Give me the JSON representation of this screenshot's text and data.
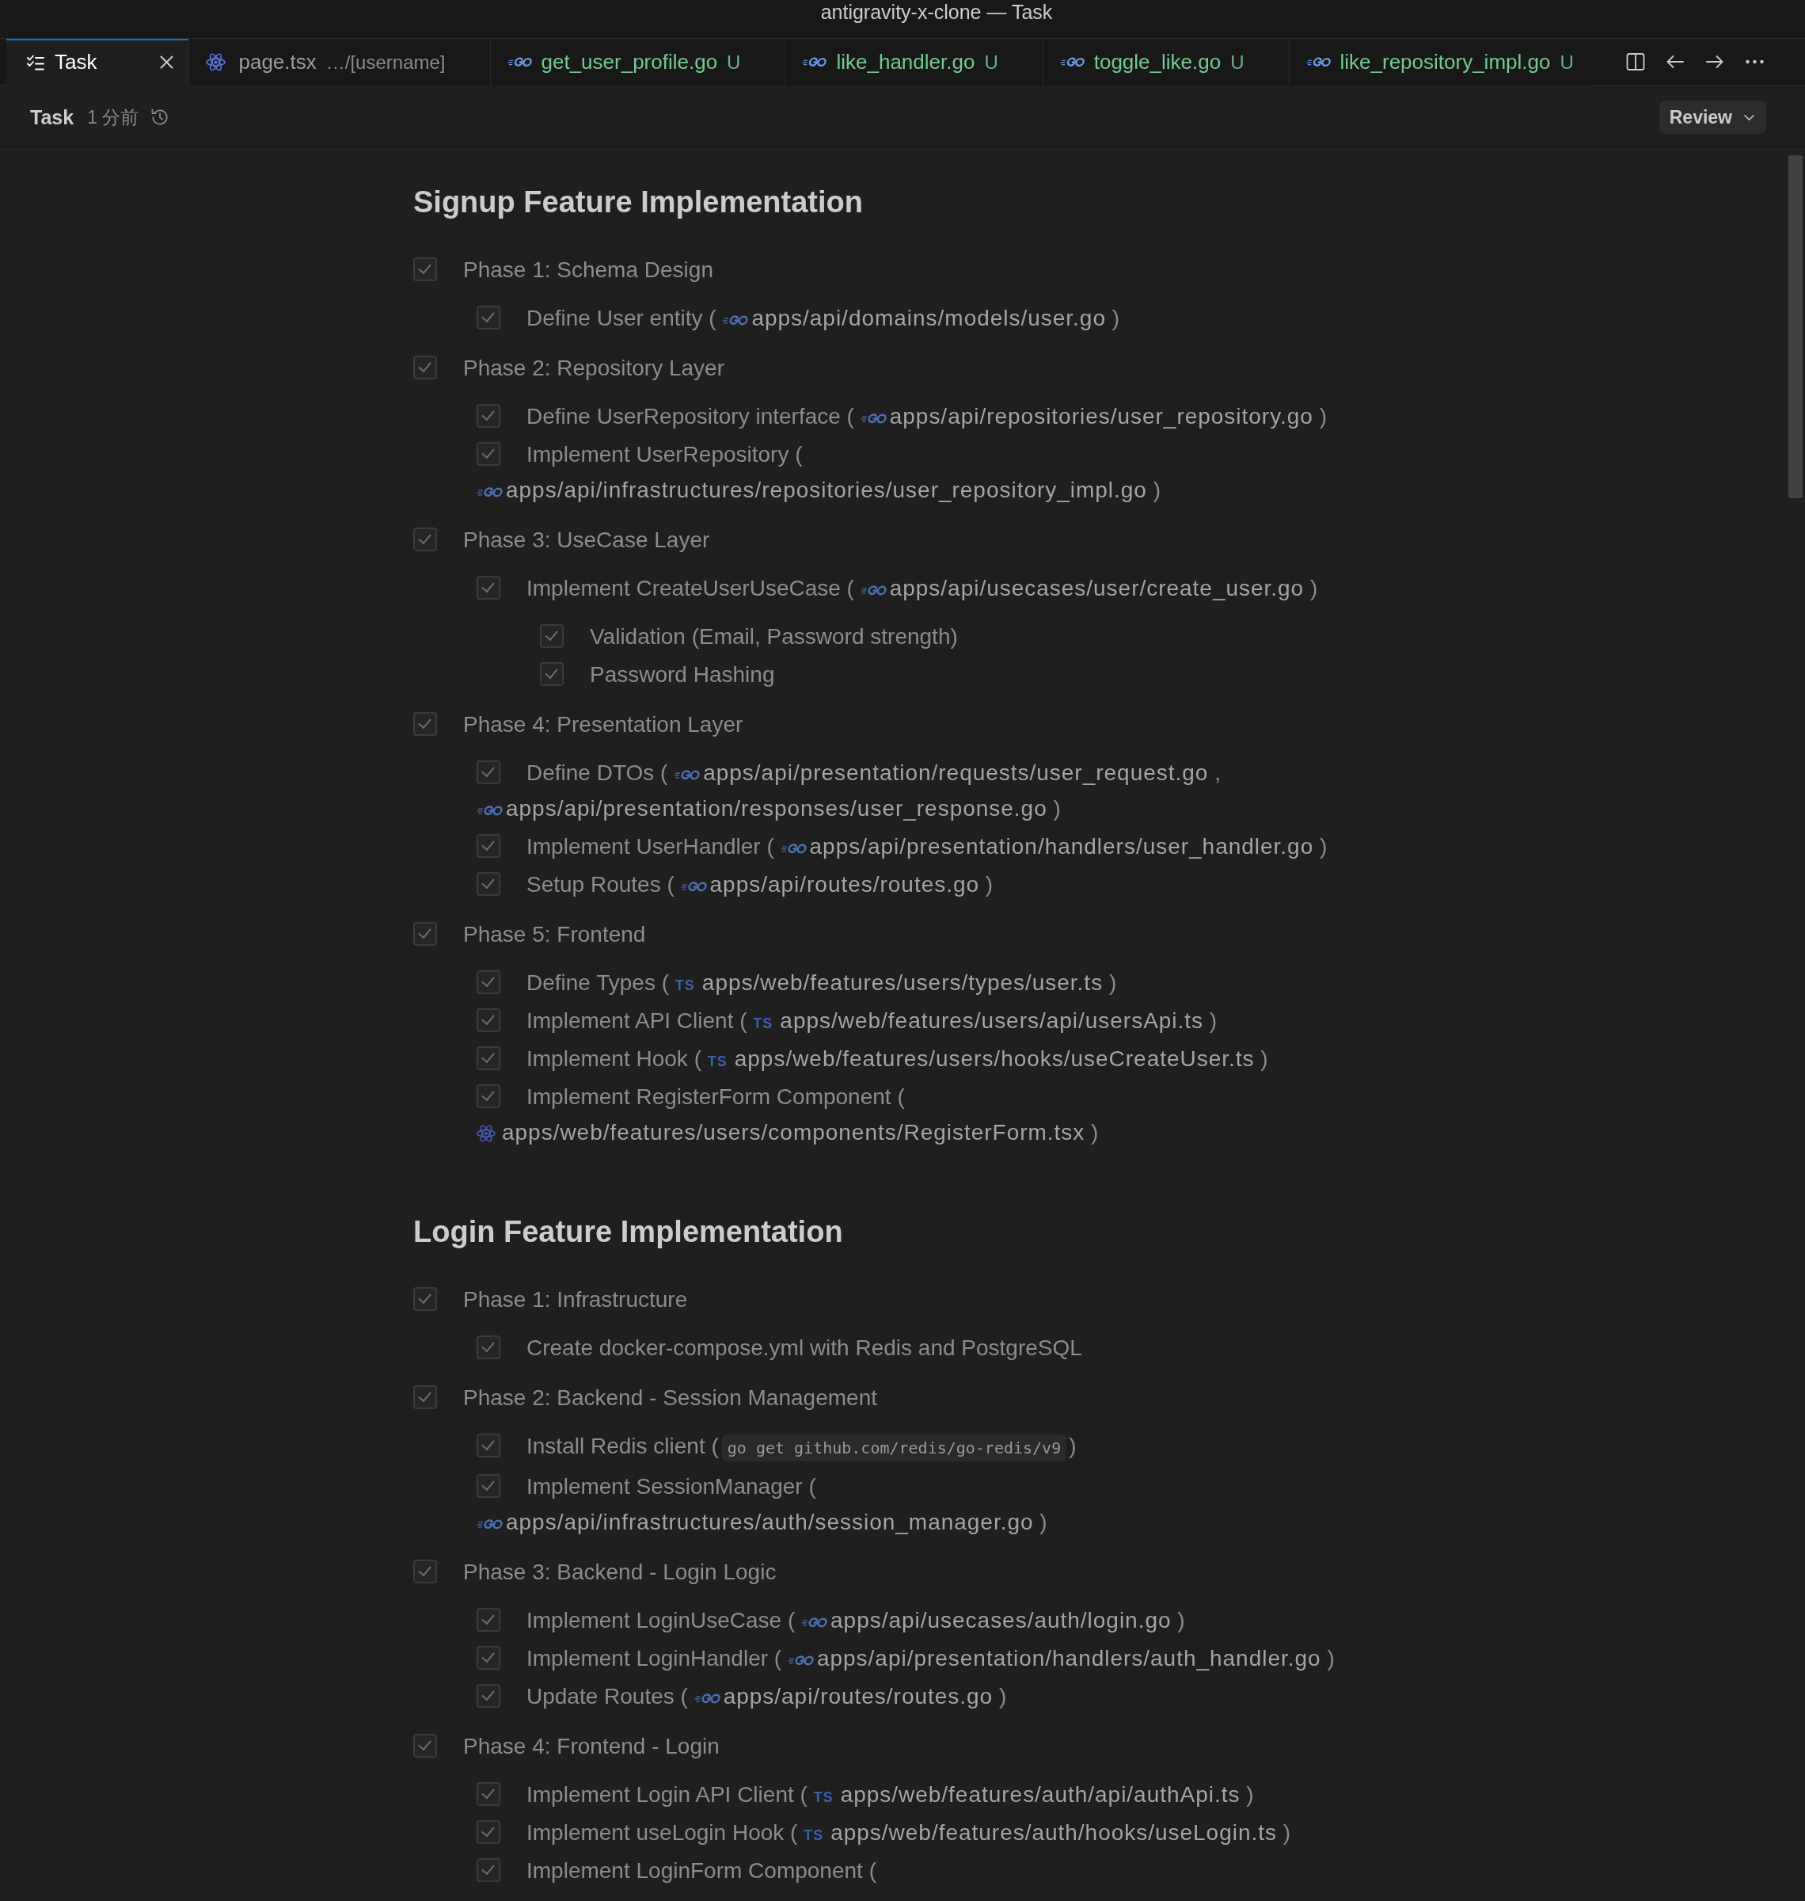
{
  "window": {
    "title": "antigravity-x-clone — Task"
  },
  "tabs": [
    {
      "kind": "task",
      "label": "Task",
      "selected": true
    },
    {
      "kind": "react",
      "label": "page.tsx",
      "detail": "…/[username]",
      "selected": false
    },
    {
      "kind": "go",
      "label": "get_user_profile.go",
      "status": "U",
      "selected": false
    },
    {
      "kind": "go",
      "label": "like_handler.go",
      "status": "U",
      "selected": false
    },
    {
      "kind": "go",
      "label": "toggle_like.go",
      "status": "U",
      "selected": false
    },
    {
      "kind": "go",
      "label": "like_repository_impl.go",
      "status": "U",
      "selected": false
    }
  ],
  "header": {
    "title": "Task",
    "time": "1 分前",
    "review_button": "Review"
  },
  "sections": [
    {
      "title": "Signup Feature Implementation",
      "items": [
        {
          "checked": true,
          "parts": [
            {
              "kind": "text",
              "text": "Phase 1: Schema Design"
            }
          ],
          "children": [
            {
              "checked": true,
              "parts": [
                {
                  "kind": "text",
                  "text": "Define User entity ("
                },
                {
                  "kind": "go",
                  "text": "apps/api/domains/models/user.go"
                },
                {
                  "kind": "text",
                  "text": ")"
                }
              ]
            }
          ]
        },
        {
          "checked": true,
          "parts": [
            {
              "kind": "text",
              "text": "Phase 2: Repository Layer"
            }
          ],
          "children": [
            {
              "checked": true,
              "parts": [
                {
                  "kind": "text",
                  "text": "Define UserRepository interface ("
                },
                {
                  "kind": "go",
                  "text": "apps/api/repositories/user_repository.go"
                },
                {
                  "kind": "text",
                  "text": ")"
                }
              ]
            },
            {
              "checked": true,
              "parts": [
                {
                  "kind": "text",
                  "text": "Implement UserRepository ("
                },
                {
                  "kind": "go",
                  "text": "apps/api/infrastructures/repositories/user_repository_impl.go"
                },
                {
                  "kind": "text",
                  "text": ")"
                }
              ]
            }
          ]
        },
        {
          "checked": true,
          "parts": [
            {
              "kind": "text",
              "text": "Phase 3: UseCase Layer"
            }
          ],
          "children": [
            {
              "checked": true,
              "parts": [
                {
                  "kind": "text",
                  "text": "Implement CreateUserUseCase ("
                },
                {
                  "kind": "go",
                  "text": "apps/api/usecases/user/create_user.go"
                },
                {
                  "kind": "text",
                  "text": ")"
                }
              ],
              "children": [
                {
                  "checked": true,
                  "parts": [
                    {
                      "kind": "text",
                      "text": "Validation (Email, Password strength)"
                    }
                  ]
                },
                {
                  "checked": true,
                  "parts": [
                    {
                      "kind": "text",
                      "text": "Password Hashing"
                    }
                  ]
                }
              ]
            }
          ]
        },
        {
          "checked": true,
          "parts": [
            {
              "kind": "text",
              "text": "Phase 4: Presentation Layer"
            }
          ],
          "children": [
            {
              "checked": true,
              "parts": [
                {
                  "kind": "text",
                  "text": "Define DTOs ("
                },
                {
                  "kind": "go",
                  "text": "apps/api/presentation/requests/user_request.go"
                },
                {
                  "kind": "text",
                  "text": ","
                },
                {
                  "kind": "go",
                  "text": "apps/api/presentation/responses/user_response.go"
                },
                {
                  "kind": "text",
                  "text": ")"
                }
              ]
            },
            {
              "checked": true,
              "parts": [
                {
                  "kind": "text",
                  "text": "Implement UserHandler ("
                },
                {
                  "kind": "go",
                  "text": "apps/api/presentation/handlers/user_handler.go"
                },
                {
                  "kind": "text",
                  "text": ")"
                }
              ]
            },
            {
              "checked": true,
              "parts": [
                {
                  "kind": "text",
                  "text": "Setup Routes ("
                },
                {
                  "kind": "go",
                  "text": "apps/api/routes/routes.go"
                },
                {
                  "kind": "text",
                  "text": ")"
                }
              ]
            }
          ]
        },
        {
          "checked": true,
          "parts": [
            {
              "kind": "text",
              "text": "Phase 5: Frontend"
            }
          ],
          "children": [
            {
              "checked": true,
              "parts": [
                {
                  "kind": "text",
                  "text": "Define Types ("
                },
                {
                  "kind": "ts",
                  "badge": "TS",
                  "text": "apps/web/features/users/types/user.ts"
                },
                {
                  "kind": "text",
                  "text": ")"
                }
              ]
            },
            {
              "checked": true,
              "parts": [
                {
                  "kind": "text",
                  "text": "Implement API Client ("
                },
                {
                  "kind": "ts",
                  "badge": "TS",
                  "text": "apps/web/features/users/api/usersApi.ts"
                },
                {
                  "kind": "text",
                  "text": ")"
                }
              ]
            },
            {
              "checked": true,
              "parts": [
                {
                  "kind": "text",
                  "text": "Implement Hook ("
                },
                {
                  "kind": "ts",
                  "badge": "TS",
                  "text": "apps/web/features/users/hooks/useCreateUser.ts"
                },
                {
                  "kind": "text",
                  "text": ")"
                }
              ]
            },
            {
              "checked": true,
              "parts": [
                {
                  "kind": "text",
                  "text": "Implement RegisterForm Component ("
                },
                {
                  "kind": "react",
                  "text": "apps/web/features/users/components/RegisterForm.tsx"
                },
                {
                  "kind": "text",
                  "text": ")"
                }
              ]
            }
          ]
        }
      ]
    },
    {
      "title": "Login Feature Implementation",
      "items": [
        {
          "checked": true,
          "parts": [
            {
              "kind": "text",
              "text": "Phase 1: Infrastructure"
            }
          ],
          "children": [
            {
              "checked": true,
              "parts": [
                {
                  "kind": "text",
                  "text": "Create docker-compose.yml with Redis and PostgreSQL"
                }
              ]
            }
          ]
        },
        {
          "checked": true,
          "parts": [
            {
              "kind": "text",
              "text": "Phase 2: Backend - Session Management"
            }
          ],
          "children": [
            {
              "checked": true,
              "parts": [
                {
                  "kind": "text",
                  "text": "Install Redis client ("
                },
                {
                  "kind": "code",
                  "text": "go get github.com/redis/go-redis/v9"
                },
                {
                  "kind": "text",
                  "text": ")"
                }
              ]
            },
            {
              "checked": true,
              "parts": [
                {
                  "kind": "text",
                  "text": "Implement SessionManager ("
                },
                {
                  "kind": "go",
                  "text": "apps/api/infrastructures/auth/session_manager.go"
                },
                {
                  "kind": "text",
                  "text": ")"
                }
              ]
            }
          ]
        },
        {
          "checked": true,
          "parts": [
            {
              "kind": "text",
              "text": "Phase 3: Backend - Login Logic"
            }
          ],
          "children": [
            {
              "checked": true,
              "parts": [
                {
                  "kind": "text",
                  "text": "Implement LoginUseCase ("
                },
                {
                  "kind": "go",
                  "text": "apps/api/usecases/auth/login.go"
                },
                {
                  "kind": "text",
                  "text": ")"
                }
              ]
            },
            {
              "checked": true,
              "parts": [
                {
                  "kind": "text",
                  "text": "Implement LoginHandler ("
                },
                {
                  "kind": "go",
                  "text": "apps/api/presentation/handlers/auth_handler.go"
                },
                {
                  "kind": "text",
                  "text": ")"
                }
              ]
            },
            {
              "checked": true,
              "parts": [
                {
                  "kind": "text",
                  "text": "Update Routes ("
                },
                {
                  "kind": "go",
                  "text": "apps/api/routes/routes.go"
                },
                {
                  "kind": "text",
                  "text": ")"
                }
              ]
            }
          ]
        },
        {
          "checked": true,
          "parts": [
            {
              "kind": "text",
              "text": "Phase 4: Frontend - Login"
            }
          ],
          "children": [
            {
              "checked": true,
              "parts": [
                {
                  "kind": "text",
                  "text": "Implement Login API Client ("
                },
                {
                  "kind": "ts",
                  "badge": "TS",
                  "text": "apps/web/features/auth/api/authApi.ts"
                },
                {
                  "kind": "text",
                  "text": ")"
                }
              ]
            },
            {
              "checked": true,
              "parts": [
                {
                  "kind": "text",
                  "text": "Implement useLogin Hook ("
                },
                {
                  "kind": "ts",
                  "badge": "TS",
                  "text": "apps/web/features/auth/hooks/useLogin.ts"
                },
                {
                  "kind": "text",
                  "text": ")"
                }
              ]
            },
            {
              "checked": true,
              "parts": [
                {
                  "kind": "text",
                  "text": "Implement LoginForm Component ("
                }
              ]
            }
          ]
        }
      ]
    }
  ]
}
